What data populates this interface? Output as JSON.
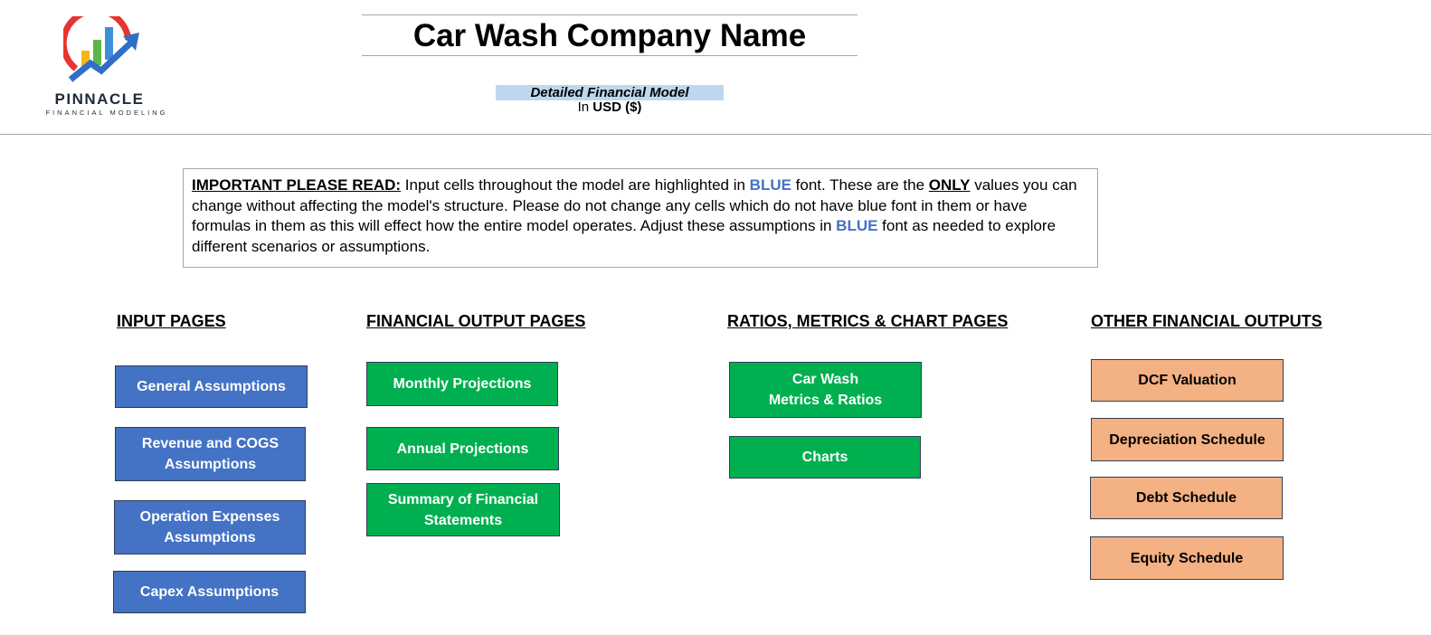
{
  "logo": {
    "name": "PINNACLE",
    "tagline": "FINANCIAL MODELING",
    "colors": {
      "ring": "#e8342e",
      "bar_yellow": "#f5b718",
      "bar_green": "#5cb646",
      "bar_blue": "#3b8fd9",
      "arrow": "#2f6fc5"
    }
  },
  "header": {
    "title": "Car Wash Company Name",
    "subtitle": "Detailed Financial Model",
    "currency_prefix": "In",
    "currency": "USD ($)"
  },
  "notice": {
    "label": "IMPORTANT PLEASE READ:",
    "t1": " Input cells throughout the model are highlighted in ",
    "blue1": "BLUE",
    "t2": " font. These are the ",
    "only": "ONLY",
    "t3": " values you can change without affecting the model's structure. Please do not change any cells which do not have blue font in them or have formulas in them as this will effect how the entire model operates. Adjust these assumptions in ",
    "blue2": "BLUE",
    "t4": " font as needed to explore different scenarios or assumptions."
  },
  "sections": {
    "input": {
      "heading": "INPUT PAGES",
      "buttons": [
        "General Assumptions",
        "Revenue and COGS\nAssumptions",
        "Operation Expenses\nAssumptions",
        "Capex Assumptions"
      ]
    },
    "financial": {
      "heading": "FINANCIAL OUTPUT PAGES",
      "buttons": [
        "Monthly Projections",
        "Annual Projections",
        "Summary of Financial\nStatements"
      ]
    },
    "ratios": {
      "heading": "RATIOS, METRICS & CHART PAGES",
      "buttons": [
        "Car Wash\nMetrics & Ratios",
        "Charts"
      ]
    },
    "other": {
      "heading": "OTHER FINANCIAL OUTPUTS",
      "buttons": [
        "DCF Valuation",
        "Depreciation Schedule",
        "Debt Schedule",
        "Equity Schedule"
      ]
    }
  },
  "colors": {
    "input_button": "#4472c4",
    "output_button": "#00b050",
    "other_button": "#f4b183",
    "highlight": "#bdd7ee",
    "blue_font": "#4472c4"
  }
}
